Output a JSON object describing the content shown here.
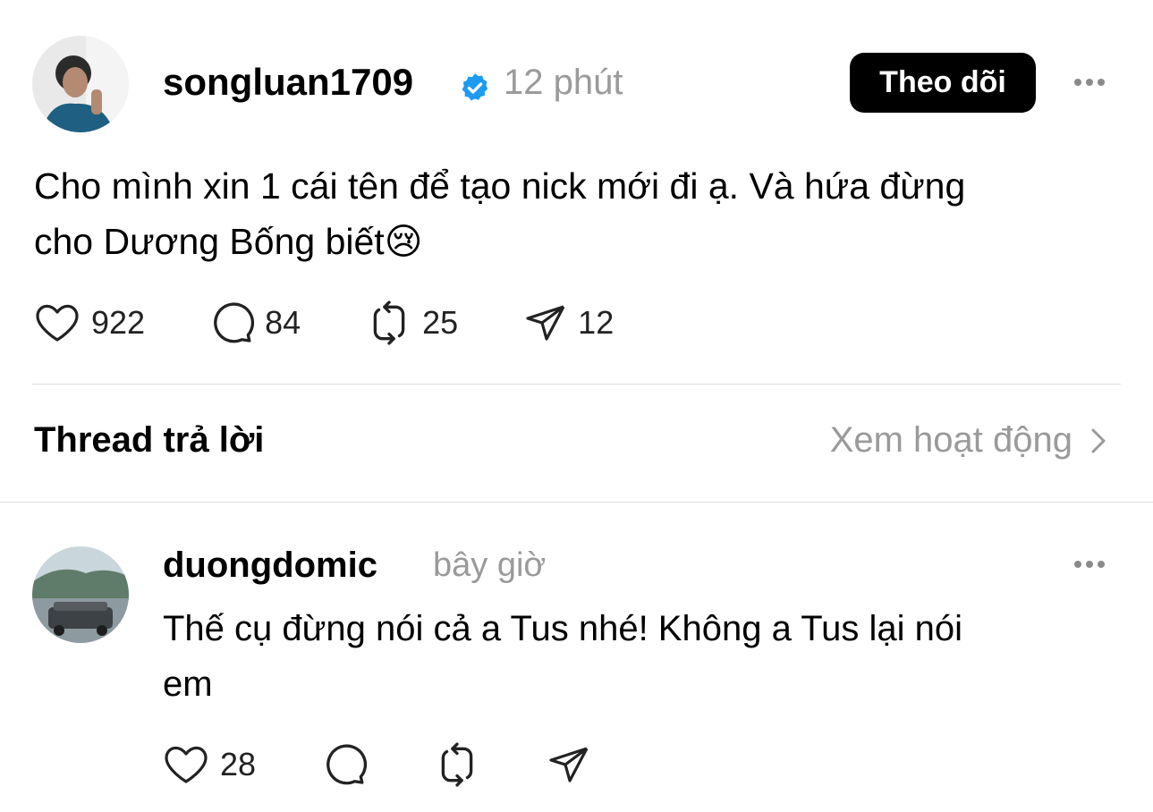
{
  "main_post": {
    "username": "songluan1709",
    "verified": true,
    "time": "12 phút",
    "follow_label": "Theo dõi",
    "text_line1": "Cho mình xin 1 cái tên để tạo nick mới đi ạ. Và hứa đừng",
    "text_line2": "cho Dương Bống biết",
    "emoji": "😢",
    "likes": "922",
    "comments": "84",
    "reposts": "25",
    "shares": "12"
  },
  "replies_section": {
    "title": "Thread trả lời",
    "view_activity": "Xem hoạt động"
  },
  "reply": {
    "username": "duongdomic",
    "time": "bây giờ",
    "text_line1": "Thế cụ đừng nói cả a Tus nhé! Không a Tus lại nói",
    "text_line2": "em",
    "likes": "28"
  },
  "colors": {
    "verified_blue": "#1d9bf0",
    "muted_gray": "#9a9a9a",
    "button_bg": "#000000"
  }
}
